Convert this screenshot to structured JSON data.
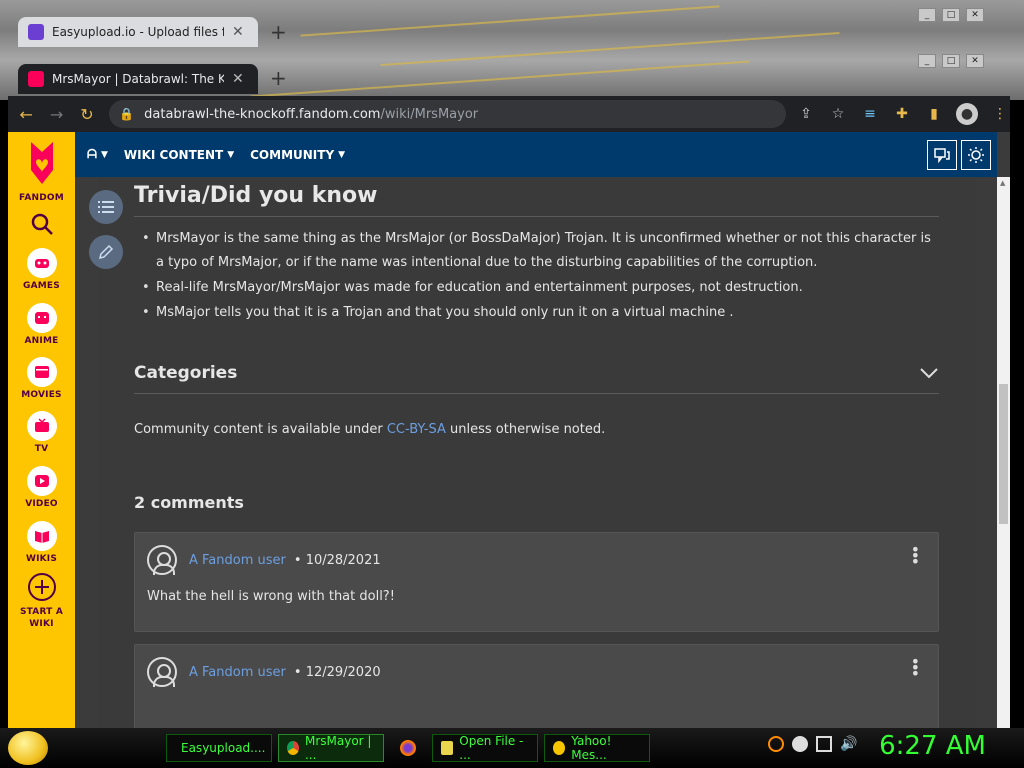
{
  "browser_back": {
    "tab_title": "Easyupload.io - Upload files for free",
    "new_tab": "+",
    "controls": [
      "_",
      "□",
      "✕"
    ]
  },
  "browser_front": {
    "tab_title": "MrsMayor | Databrawl: The Knockoff",
    "new_tab": "+",
    "controls": [
      "_",
      "□",
      "✕"
    ],
    "url_host": "databrawl-the-knockoff.fandom.com",
    "url_path": "/wiki/MrsMayor"
  },
  "rail": {
    "logo_label": "FANDOM",
    "items": [
      {
        "label": "GAMES"
      },
      {
        "label": "ANIME"
      },
      {
        "label": "MOVIES"
      },
      {
        "label": "TV"
      },
      {
        "label": "VIDEO"
      },
      {
        "label": "WIKIS"
      },
      {
        "label": "START A WIKI"
      }
    ]
  },
  "topnav": {
    "items": [
      {
        "label": "ᗩ"
      },
      {
        "label": "WIKI CONTENT"
      },
      {
        "label": "COMMUNITY"
      }
    ]
  },
  "article": {
    "section_title": "Trivia/Did you know",
    "bullets": [
      "MrsMayor is the same thing as the MrsMajor (or BossDaMajor) Trojan. It is unconfirmed whether or not this character is a typo of MrsMajor, or if the name was intentional due to the disturbing capabilities of the corruption.",
      "Real-life MrsMayor/MrsMajor was made for education and entertainment purposes, not destruction.",
      "MsMajor tells you that it is a Trojan and that you should only run it on a virtual machine ."
    ],
    "categories_label": "Categories",
    "license_prefix": "Community content is available under ",
    "license_link": "CC-BY-SA",
    "license_suffix": " unless otherwise noted."
  },
  "comments": {
    "title": "2 comments",
    "items": [
      {
        "user": "A Fandom user",
        "date": "10/28/2021",
        "body": "What the hell is wrong with that doll?!"
      },
      {
        "user": "A Fandom user",
        "date": "12/29/2020",
        "body": ""
      }
    ]
  },
  "taskbar": {
    "tasks": [
      {
        "label": "Easyupload...."
      },
      {
        "label": "MrsMayor | ..."
      },
      {
        "label": "Open File - ..."
      },
      {
        "label": "Yahoo! Mes..."
      }
    ],
    "clock": "6:27 AM"
  },
  "colors": {
    "rail": "#fec600",
    "topnav": "#00396b",
    "link": "#6d9fe0",
    "clock": "#33ff33"
  }
}
